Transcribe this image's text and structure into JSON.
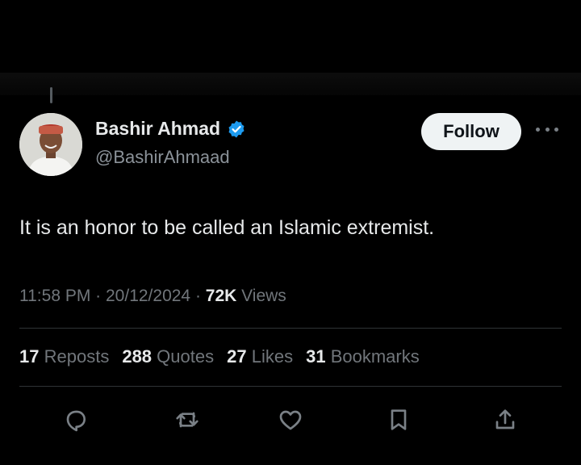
{
  "tweet": {
    "author": {
      "name": "Bashir Ahmad",
      "handle": "@BashirAhmaad",
      "verified": true
    },
    "follow_label": "Follow",
    "text": "It is an honor to be called an Islamic extremist.",
    "time": "11:58 PM",
    "date": "20/12/2024",
    "views_count": "72K",
    "views_label": "Views",
    "stats": [
      {
        "value": "17",
        "label": "Reposts"
      },
      {
        "value": "288",
        "label": "Quotes"
      },
      {
        "value": "27",
        "label": "Likes"
      },
      {
        "value": "31",
        "label": "Bookmarks"
      }
    ]
  },
  "colors": {
    "background": "#000000",
    "text": "#e7e9ea",
    "secondary": "#71767b",
    "verified_blue": "#1d9bf0",
    "follow_bg": "#eff3f4"
  },
  "icons": {
    "verified": "verified-badge",
    "more": "more-dots",
    "actions": [
      "reply-icon",
      "repost-icon",
      "like-icon",
      "bookmark-icon",
      "share-icon"
    ]
  }
}
